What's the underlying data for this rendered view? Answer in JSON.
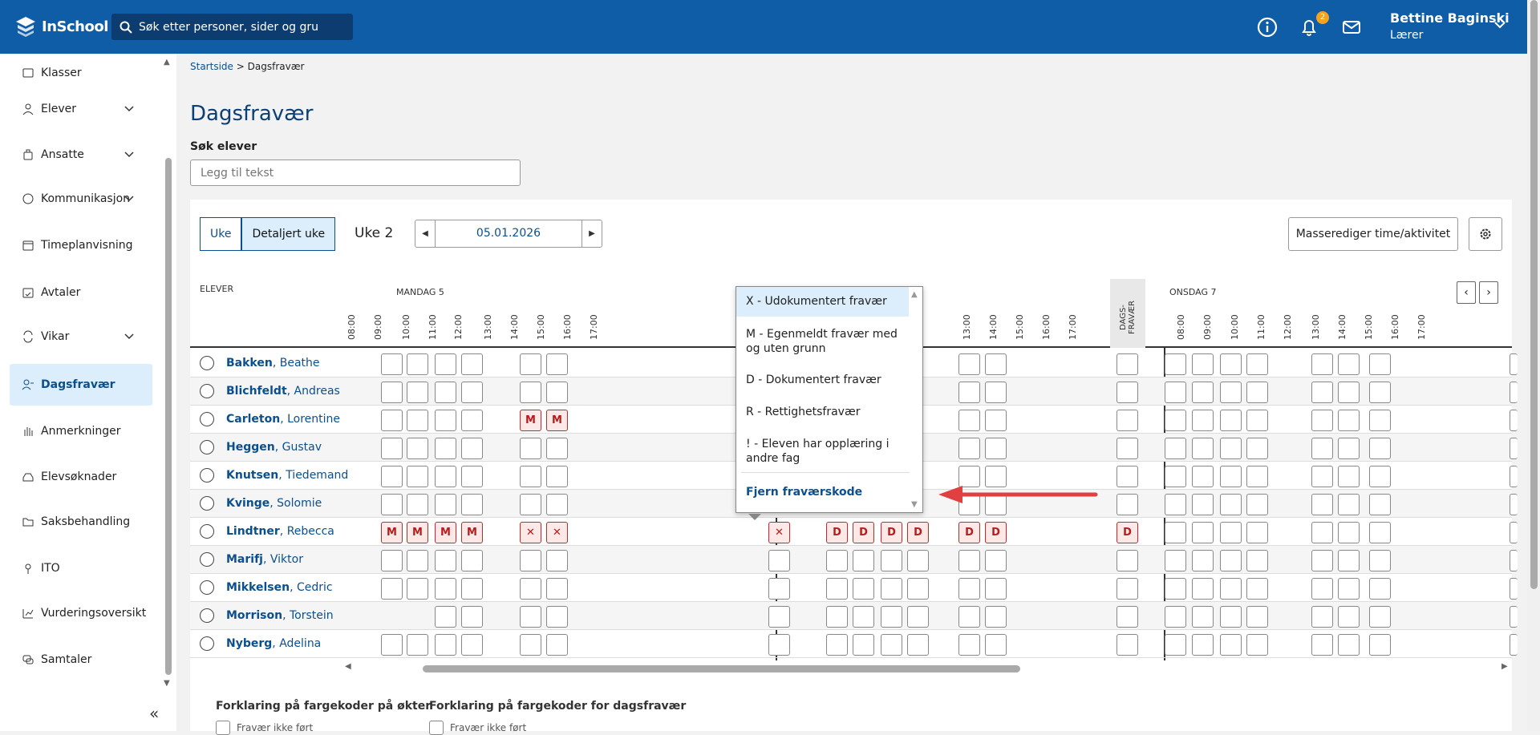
{
  "app": {
    "name": "InSchool"
  },
  "search": {
    "placeholder": "Søk etter personer, sider og gru"
  },
  "notifications": {
    "count": "2"
  },
  "user": {
    "name": "Bettine Baginski",
    "role": "Lærer"
  },
  "sidebar": {
    "items": [
      {
        "label": "Klasser",
        "icon": "class-icon",
        "expandable": false,
        "active": false
      },
      {
        "label": "Elever",
        "icon": "students-icon",
        "expandable": true,
        "active": false
      },
      {
        "label": "Ansatte",
        "icon": "staff-icon",
        "expandable": true,
        "active": false
      },
      {
        "label": "Kommunikasjon",
        "icon": "chat-icon",
        "expandable": true,
        "active": false
      },
      {
        "label": "Timeplanvisning",
        "icon": "calendar-icon",
        "expandable": false,
        "active": false
      },
      {
        "label": "Avtaler",
        "icon": "calendar-check-icon",
        "expandable": false,
        "active": false
      },
      {
        "label": "Vikar",
        "icon": "swap-icon",
        "expandable": true,
        "active": false
      },
      {
        "label": "Dagsfravær",
        "icon": "person-absent-icon",
        "expandable": false,
        "active": true
      },
      {
        "label": "Anmerkninger",
        "icon": "hand-icon",
        "expandable": false,
        "active": false
      },
      {
        "label": "Elevsøknader",
        "icon": "inbox-icon",
        "expandable": false,
        "active": false
      },
      {
        "label": "Saksbehandling",
        "icon": "folder-icon",
        "expandable": false,
        "active": false
      },
      {
        "label": "ITO",
        "icon": "pin-icon",
        "expandable": false,
        "active": false
      },
      {
        "label": "Vurderingsoversikt",
        "icon": "chart-icon",
        "expandable": false,
        "active": false
      },
      {
        "label": "Samtaler",
        "icon": "conversation-icon",
        "expandable": false,
        "active": false
      }
    ]
  },
  "breadcrumb": {
    "home": "Startside",
    "separator": ">",
    "current": "Dagsfravær"
  },
  "page": {
    "title": "Dagsfravær",
    "search_label": "Søk elever",
    "search_placeholder": "Legg til tekst"
  },
  "toolbar": {
    "tab_week": "Uke",
    "tab_detail": "Detaljert uke",
    "week_label": "Uke 2",
    "date": "05.01.2026",
    "mass_edit": "Masserediger time/aktivitet"
  },
  "grid": {
    "students_header": "ELEVER",
    "day_monday": "MANDAG 5",
    "day_wednesday": "ONSDAG 7",
    "dags_header": "DAGS- FRAVÆR",
    "hours_monday": [
      "08:00",
      "09:00",
      "10:00",
      "11:00",
      "12:00",
      "13:00",
      "14:00",
      "15:00",
      "16:00",
      "17:00"
    ],
    "hours_tuesday": [
      "13:00",
      "14:00",
      "15:00",
      "16:00",
      "17:00"
    ],
    "hours_wednesday": [
      "08:00",
      "09:00",
      "10:00",
      "11:00",
      "12:00",
      "13:00",
      "14:00",
      "15:00",
      "16:00",
      "17:00"
    ],
    "students": [
      {
        "last": "Bakken",
        "first": "Beathe",
        "mon": [
          "",
          "",
          "",
          "",
          "",
          ""
        ],
        "tue": [
          "",
          "",
          "",
          "",
          "",
          "",
          "",
          ""
        ],
        "dags": ""
      },
      {
        "last": "Blichfeldt",
        "first": "Andreas",
        "mon": [
          "",
          "",
          "",
          "",
          "",
          ""
        ],
        "tue": [
          "",
          "",
          "",
          "",
          "",
          "",
          "",
          ""
        ],
        "dags": ""
      },
      {
        "last": "Carleton",
        "first": "Lorentine",
        "mon": [
          "",
          "",
          "",
          "",
          "M",
          "M"
        ],
        "tue": [
          "",
          "",
          "",
          "",
          "",
          "",
          "",
          ""
        ],
        "dags": ""
      },
      {
        "last": "Heggen",
        "first": "Gustav",
        "mon": [
          "",
          "",
          "",
          "",
          "",
          ""
        ],
        "tue": [
          "",
          "",
          "",
          "",
          "",
          "",
          "",
          ""
        ],
        "dags": ""
      },
      {
        "last": "Knutsen",
        "first": "Tiedemand",
        "mon": [
          "",
          "",
          "",
          "",
          "",
          ""
        ],
        "tue": [
          "",
          "",
          "",
          "",
          "",
          "",
          "",
          ""
        ],
        "dags": ""
      },
      {
        "last": "Kvinge",
        "first": "Solomie",
        "mon": [
          "",
          "",
          "",
          "",
          "",
          ""
        ],
        "tue": [
          "",
          "",
          "",
          "",
          "",
          "",
          "",
          ""
        ],
        "dags": ""
      },
      {
        "last": "Lindtner",
        "first": "Rebecca",
        "mon": [
          "M",
          "M",
          "M",
          "M",
          "✕",
          "✕"
        ],
        "tue": [
          "✕",
          "D",
          "D",
          "D",
          "D",
          "D",
          "D"
        ],
        "dags": "D"
      },
      {
        "last": "Marifj",
        "first": "Viktor",
        "mon": [
          "",
          "",
          "",
          "",
          "",
          ""
        ],
        "tue": [
          "",
          "",
          "",
          "",
          "",
          "",
          "",
          ""
        ],
        "dags": ""
      },
      {
        "last": "Mikkelsen",
        "first": "Cedric",
        "mon": [
          "",
          "",
          "",
          "",
          "",
          ""
        ],
        "tue": [
          "",
          "",
          "",
          "",
          "",
          "",
          "",
          ""
        ],
        "dags": ""
      },
      {
        "last": "Morrison",
        "first": "Torstein",
        "mon": [
          "-",
          "-",
          "",
          "",
          "",
          ""
        ],
        "tue": [
          "",
          "",
          "",
          "",
          "",
          "",
          "",
          ""
        ],
        "dags": ""
      },
      {
        "last": "Nyberg",
        "first": "Adelina",
        "mon": [
          "",
          "",
          "",
          "",
          "",
          ""
        ],
        "tue": [
          "",
          "",
          "",
          "",
          "",
          "",
          "",
          ""
        ],
        "dags": ""
      }
    ]
  },
  "dropdown": {
    "items": [
      "X - Udokumentert fravær",
      "M - Egenmeldt fravær med og uten grunn",
      "D - Dokumentert fravær",
      "R - Rettighetsfravær",
      "! - Eleven har opplæring i andre fag"
    ],
    "remove": "Fjern fraværskode"
  },
  "legend": {
    "sessions": "Forklaring på fargekoder på økter",
    "daily": "Forklaring på fargekoder for dagsfravær",
    "check1": "Fravær ikke ført",
    "check2": "Fravær ikke ført"
  },
  "colors": {
    "brand": "#0f5da6",
    "absence_red": "#c62828",
    "accent_arrow": "#e04040"
  }
}
